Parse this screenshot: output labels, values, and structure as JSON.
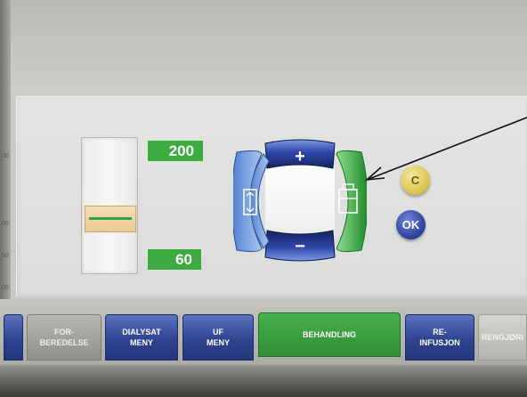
{
  "limits": {
    "upper_value": "200",
    "lower_value": "60"
  },
  "edge_marks": [
    "00",
    "00",
    "50",
    "00"
  ],
  "controls": {
    "plus_label": "+",
    "minus_label": "−",
    "c_label": "C",
    "ok_label": "OK",
    "icons": [
      "plus-icon",
      "minus-icon",
      "expand-vertical-icon",
      "window-icon",
      "arrow-pointer-icon"
    ]
  },
  "tabs": [
    {
      "label": "",
      "style": "blue"
    },
    {
      "label": "FOR-\nBEREDELSE",
      "style": "grey"
    },
    {
      "label": "DIALYSAT\nMENY",
      "style": "blue"
    },
    {
      "label": "UF\nMENY",
      "style": "blue"
    },
    {
      "label": "BEHANDLING",
      "style": "green"
    },
    {
      "label": "RE-\nINFUSJON",
      "style": "blue"
    },
    {
      "label": "RENGJØRI",
      "style": "light"
    }
  ],
  "colors": {
    "accent_green": "#3dab3f",
    "accent_blue": "#2f4390",
    "handle": "#ebcb94"
  }
}
